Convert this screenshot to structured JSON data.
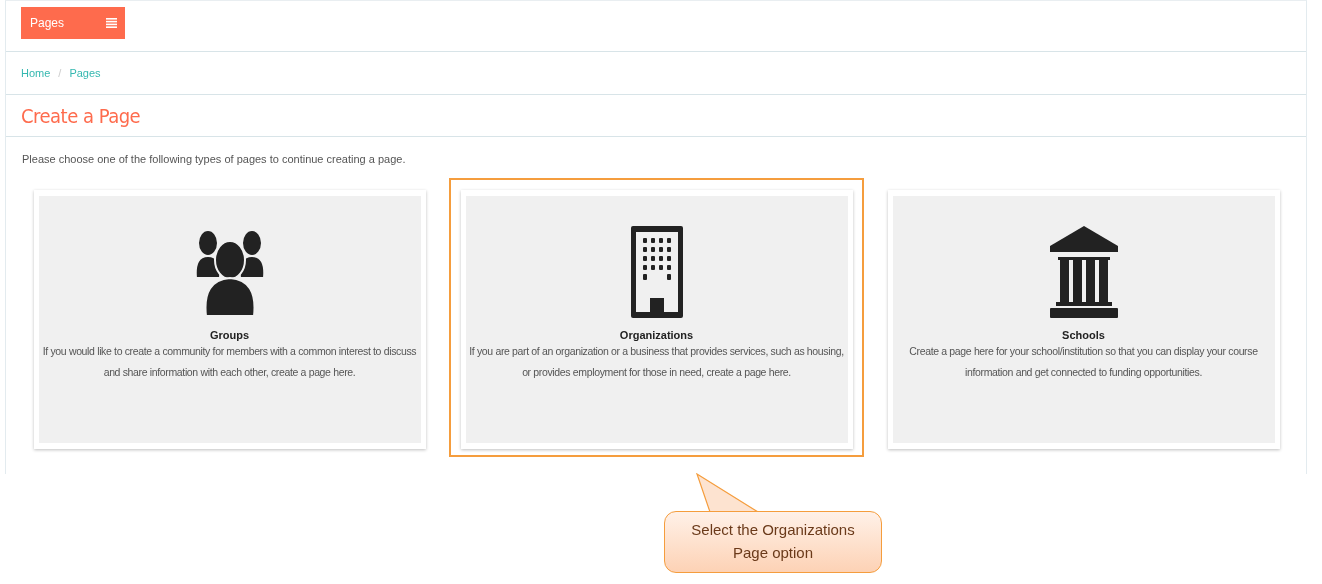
{
  "menu_button": {
    "label": "Pages"
  },
  "breadcrumb": [
    {
      "label": "Home"
    },
    {
      "label": "Pages"
    }
  ],
  "breadcrumb_separator": "/",
  "heading": "Create a Page",
  "intro": "Please choose one of the following types of pages to continue creating a page.",
  "cards": [
    {
      "kind": "groups",
      "title": "Groups",
      "text": "If you would like to create a community for members with a common interest to discuss and share information with each other, create a page here.",
      "highlighted": false
    },
    {
      "kind": "organizations",
      "title": "Organizations",
      "text": "If you are part of an organization or a business that provides services, such as housing, or provides employment for those in need, create a page here.",
      "highlighted": true
    },
    {
      "kind": "schools",
      "title": "Schools",
      "text": "Create a page here for your school/institution so that you can display your course information and get connected to funding opportunities.",
      "highlighted": false
    }
  ],
  "callout": {
    "text": "Select the Organizations Page option"
  }
}
